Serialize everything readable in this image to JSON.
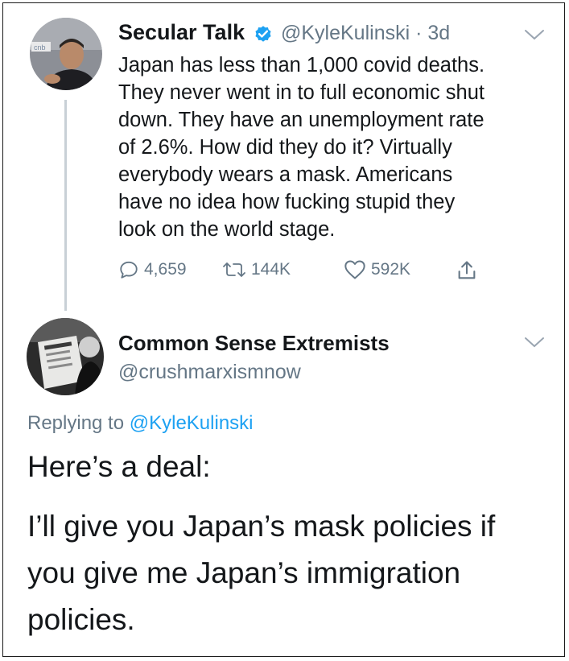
{
  "original_tweet": {
    "display_name": "Secular Talk",
    "handle": "@KyleKulinski",
    "time": "3d",
    "text": "Japan has less than 1,000 covid deaths.\nThey never went in to full economic shut\ndown. They have an unemployment rate\nof 2.6%. How did they do it? Virtually\neverybody wears a mask. Americans\nhave no idea how fucking stupid they\nlook on the world stage.",
    "replies": "4,659",
    "retweets": "144K",
    "likes": "592K",
    "avatar_sign_text": "cnb"
  },
  "reply_tweet": {
    "display_name": "Common Sense Extremists",
    "handle": "@crushmarxismnow",
    "replying_prefix": "Replying to",
    "replying_handle": "@KyleKulinski",
    "line1": "Here’s a deal:",
    "line2": "I’ll give you Japan’s mask policies if",
    "line3": "you give me Japan’s immigration",
    "line4": "policies."
  },
  "colors": {
    "text": "#14171a",
    "secondary": "#657786",
    "link": "#1da1f2",
    "verified": "#1da1f2"
  }
}
